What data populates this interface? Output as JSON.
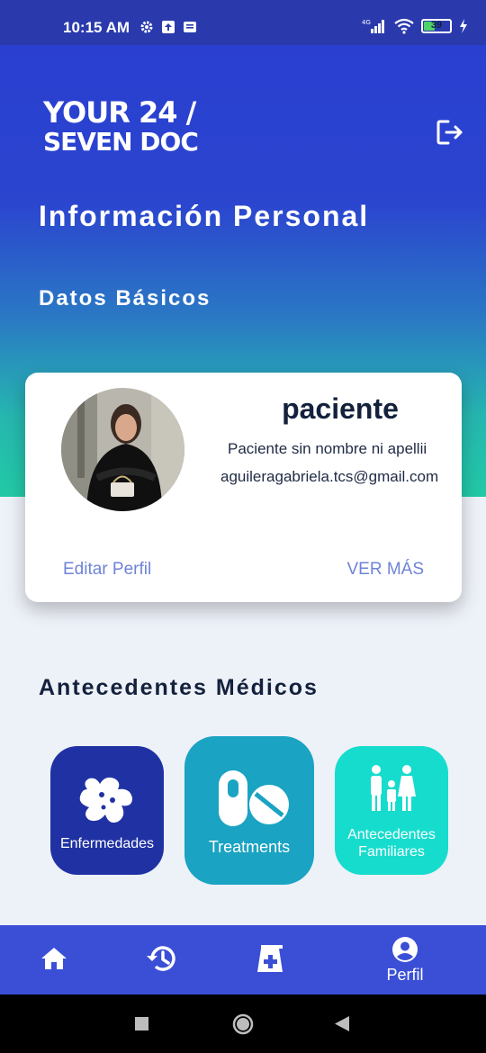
{
  "status_bar": {
    "time": "10:15 AM",
    "network": "4G",
    "battery_percent": "39",
    "battery_level": 0.39
  },
  "header": {
    "logo_line1": "YOUR 24 /",
    "logo_line2": "SEVEN DOC",
    "logout_icon": "logout-icon"
  },
  "page": {
    "title": "Información Personal",
    "basic_section": "Datos Básicos"
  },
  "profile": {
    "username": "paciente",
    "full_name": "Paciente sin nombre ni apellii",
    "email": "aguileragabriela.tcs@gmail.com",
    "edit_label": "Editar Perfil",
    "more_label": "VER MÁS"
  },
  "medical": {
    "title": "Antecedentes Médicos",
    "tiles": [
      {
        "label": "Enfermedades",
        "icon": "virus-icon",
        "color": "#2032a3"
      },
      {
        "label": "Treatments",
        "icon": "pills-icon",
        "color": "#1aa3c2"
      },
      {
        "label": "Antecedentes Familiares",
        "icon": "family-icon",
        "color": "#16dccd"
      }
    ]
  },
  "bottom_nav": {
    "items": [
      {
        "icon": "home-icon"
      },
      {
        "icon": "history-icon"
      },
      {
        "icon": "prescription-icon"
      },
      {
        "icon": "account-icon",
        "label": "Perfil"
      }
    ]
  },
  "colors": {
    "primary": "#2a3fd0",
    "accent": "#22c9a6",
    "nav": "#3a4fd6",
    "link": "#6f83d6"
  }
}
